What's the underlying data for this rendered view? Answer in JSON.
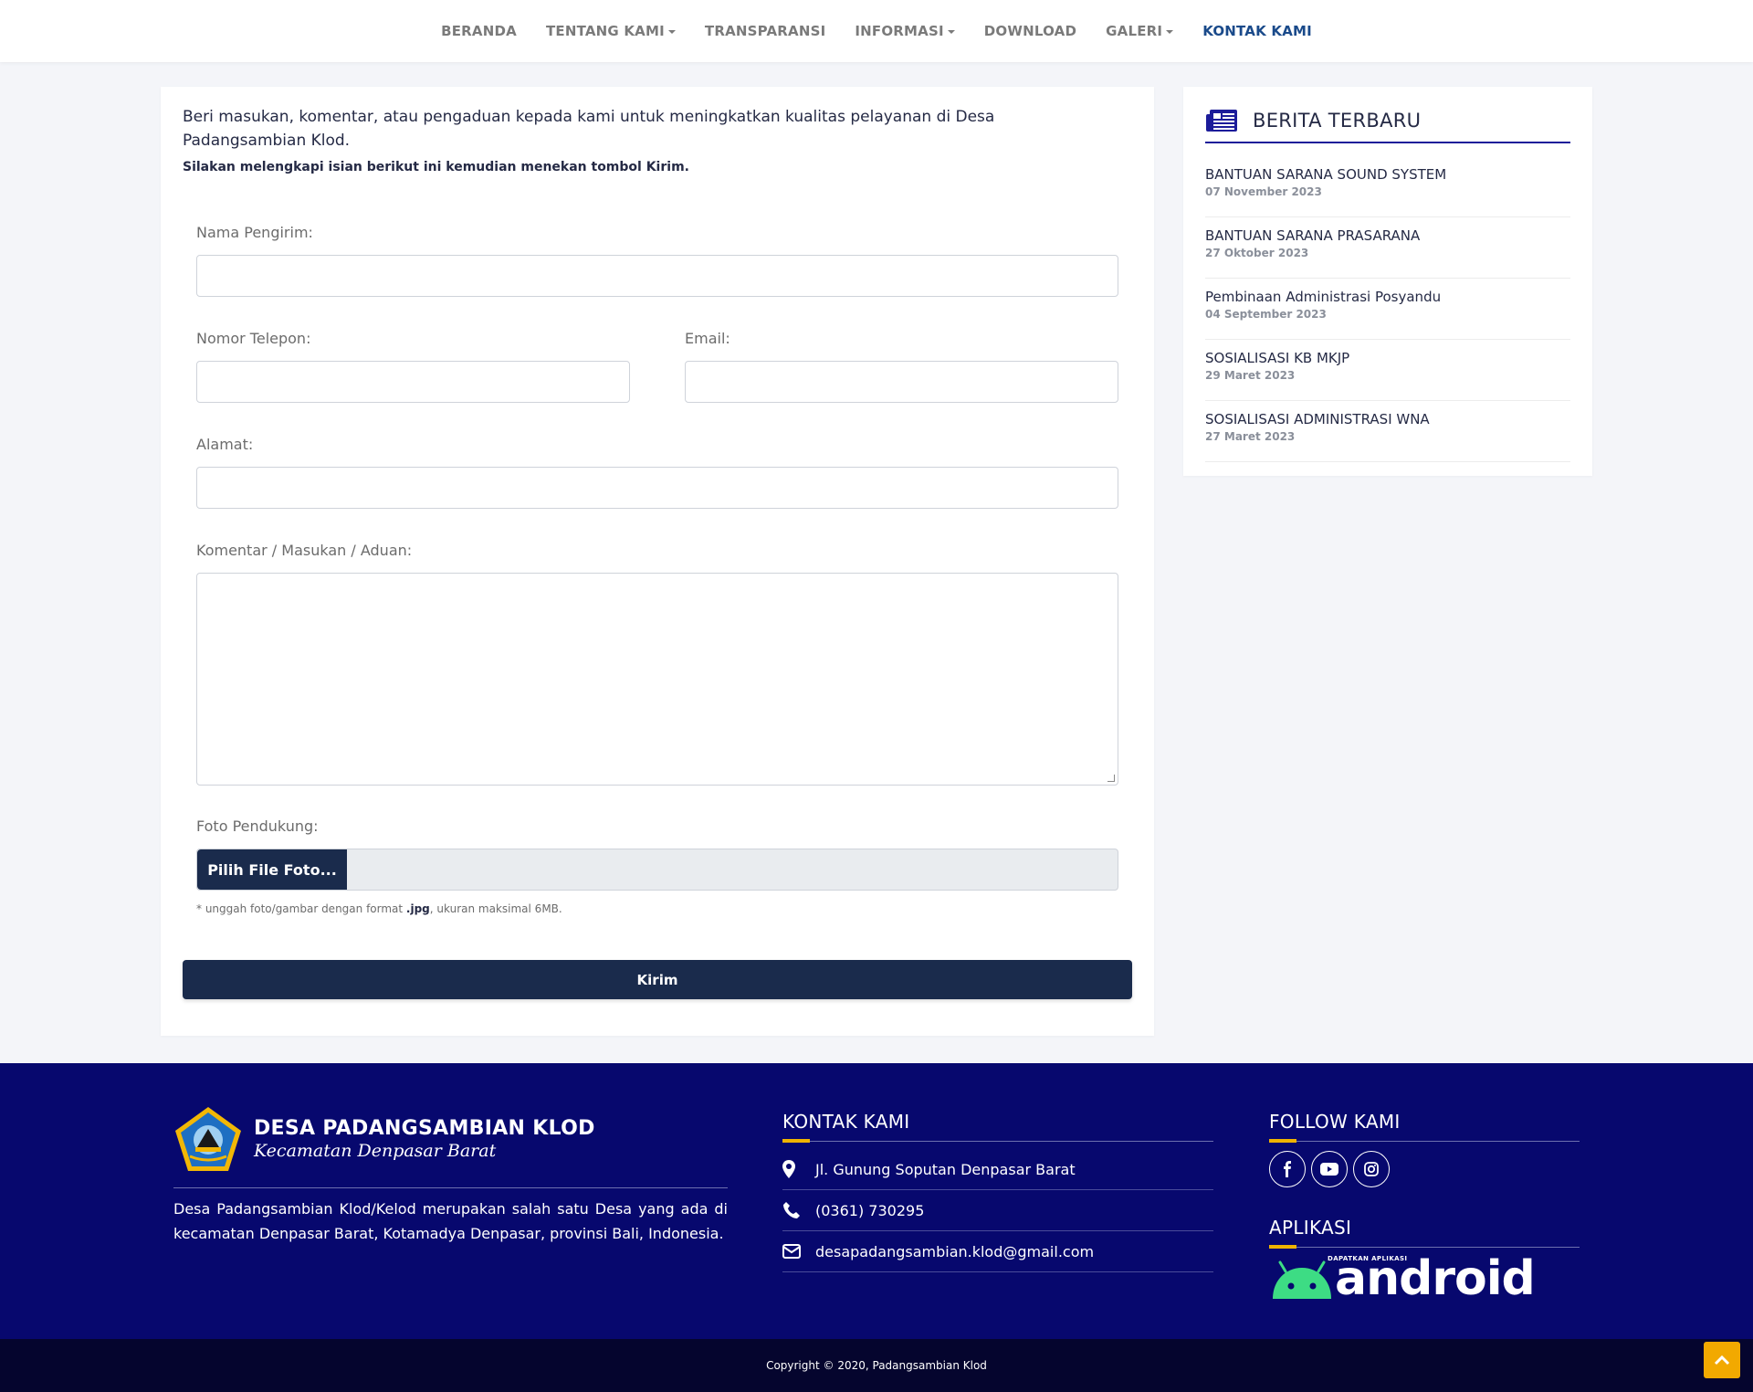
{
  "nav": {
    "items": [
      {
        "label": "BERANDA",
        "dropdown": false
      },
      {
        "label": "TENTANG KAMI",
        "dropdown": true
      },
      {
        "label": "TRANSPARANSI",
        "dropdown": false
      },
      {
        "label": "INFORMASI",
        "dropdown": true
      },
      {
        "label": "DOWNLOAD",
        "dropdown": false
      },
      {
        "label": "GALERI",
        "dropdown": true
      },
      {
        "label": "KONTAK KAMI",
        "dropdown": false,
        "active": true
      }
    ]
  },
  "form": {
    "intro": "Beri masukan, komentar, atau pengaduan kepada kami untuk meningkatkan kualitas pelayanan di Desa Padangsambian Klod.",
    "subintro": "Silakan melengkapi isian berikut ini kemudian menekan tombol Kirim.",
    "name_label": "Nama Pengirim:",
    "phone_label": "Nomor Telepon:",
    "email_label": "Email:",
    "address_label": "Alamat:",
    "comment_label": "Komentar / Masukan / Aduan:",
    "photo_label": "Foto Pendukung:",
    "file_button": "Pilih File Foto...",
    "note_prefix": "* unggah foto/gambar dengan format ",
    "note_format": ".jpg",
    "note_suffix": ", ukuran maksimal 6MB.",
    "submit_label": "Kirim"
  },
  "sidebar": {
    "title": "BERITA TERBARU",
    "news": [
      {
        "title": "BANTUAN SARANA SOUND SYSTEM",
        "date": "07 November 2023"
      },
      {
        "title": "BANTUAN SARANA PRASARANA",
        "date": "27 Oktober 2023"
      },
      {
        "title": "Pembinaan Administrasi Posyandu",
        "date": "04 September 2023"
      },
      {
        "title": "SOSIALISASI KB MKJP",
        "date": "29 Maret 2023"
      },
      {
        "title": "SOSIALISASI ADMINISTRASI WNA",
        "date": "27 Maret 2023"
      }
    ]
  },
  "footer": {
    "logo_title": "DESA PADANGSAMBIAN KLOD",
    "logo_subtitle": "Kecamatan Denpasar Barat",
    "about": "Desa Padangsambian Klod/Kelod merupakan salah satu Desa yang ada di kecamatan Denpasar Barat, Kotamadya Denpasar, provinsi Bali, Indonesia.",
    "contact_heading": "KONTAK KAMI",
    "address": "Jl. Gunung Soputan Denpasar Barat",
    "phone": "(0361) 730295",
    "email": "desapadangsambian.klod@gmail.com",
    "follow_heading": "FOLLOW KAMI",
    "app_heading": "APLIKASI",
    "android_small": "DAPATKAN APLIKASI",
    "android_word": "android",
    "copyright": "Copyright © 2020, Padangsambian Klod"
  },
  "colors": {
    "primary": "#1a2b4c",
    "footer_bg": "#07086e",
    "copy_bg": "#05052e",
    "accent": "#f0b400",
    "nav_active": "#1a4a8a",
    "android_green": "#3ddc84"
  }
}
